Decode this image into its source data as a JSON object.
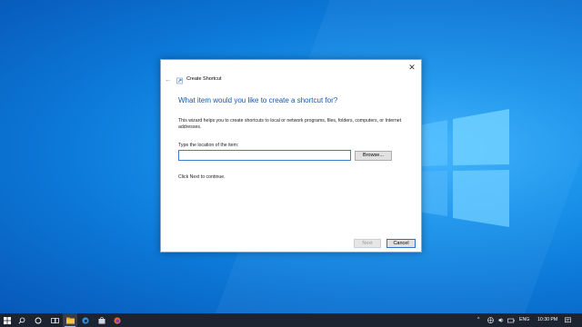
{
  "dialog": {
    "title": "Create Shortcut",
    "heading": "What item would you like to create a shortcut for?",
    "description": "This wizard helps you to create shortcuts to local or network programs, files, folders, computers, or Internet addresses.",
    "location_label": "Type the location of the item:",
    "location_value": "",
    "browse_label": "Browse...",
    "hint": "Click Next to continue.",
    "next_label": "Next",
    "cancel_label": "Cancel",
    "close_glyph": "✕",
    "back_glyph": "←"
  },
  "taskbar": {
    "icons": [
      "windows-start-icon",
      "search-icon",
      "cortana-icon",
      "task-view-icon",
      "file-explorer-icon",
      "edge-icon",
      "store-icon",
      "firefox-icon"
    ],
    "tray": {
      "chevron": "^",
      "language": "ENG",
      "time": "10:30 PM"
    }
  },
  "colors": {
    "accent": "#1a58a8",
    "taskbar": "#1c2431",
    "desktop": "#0c79d8"
  }
}
